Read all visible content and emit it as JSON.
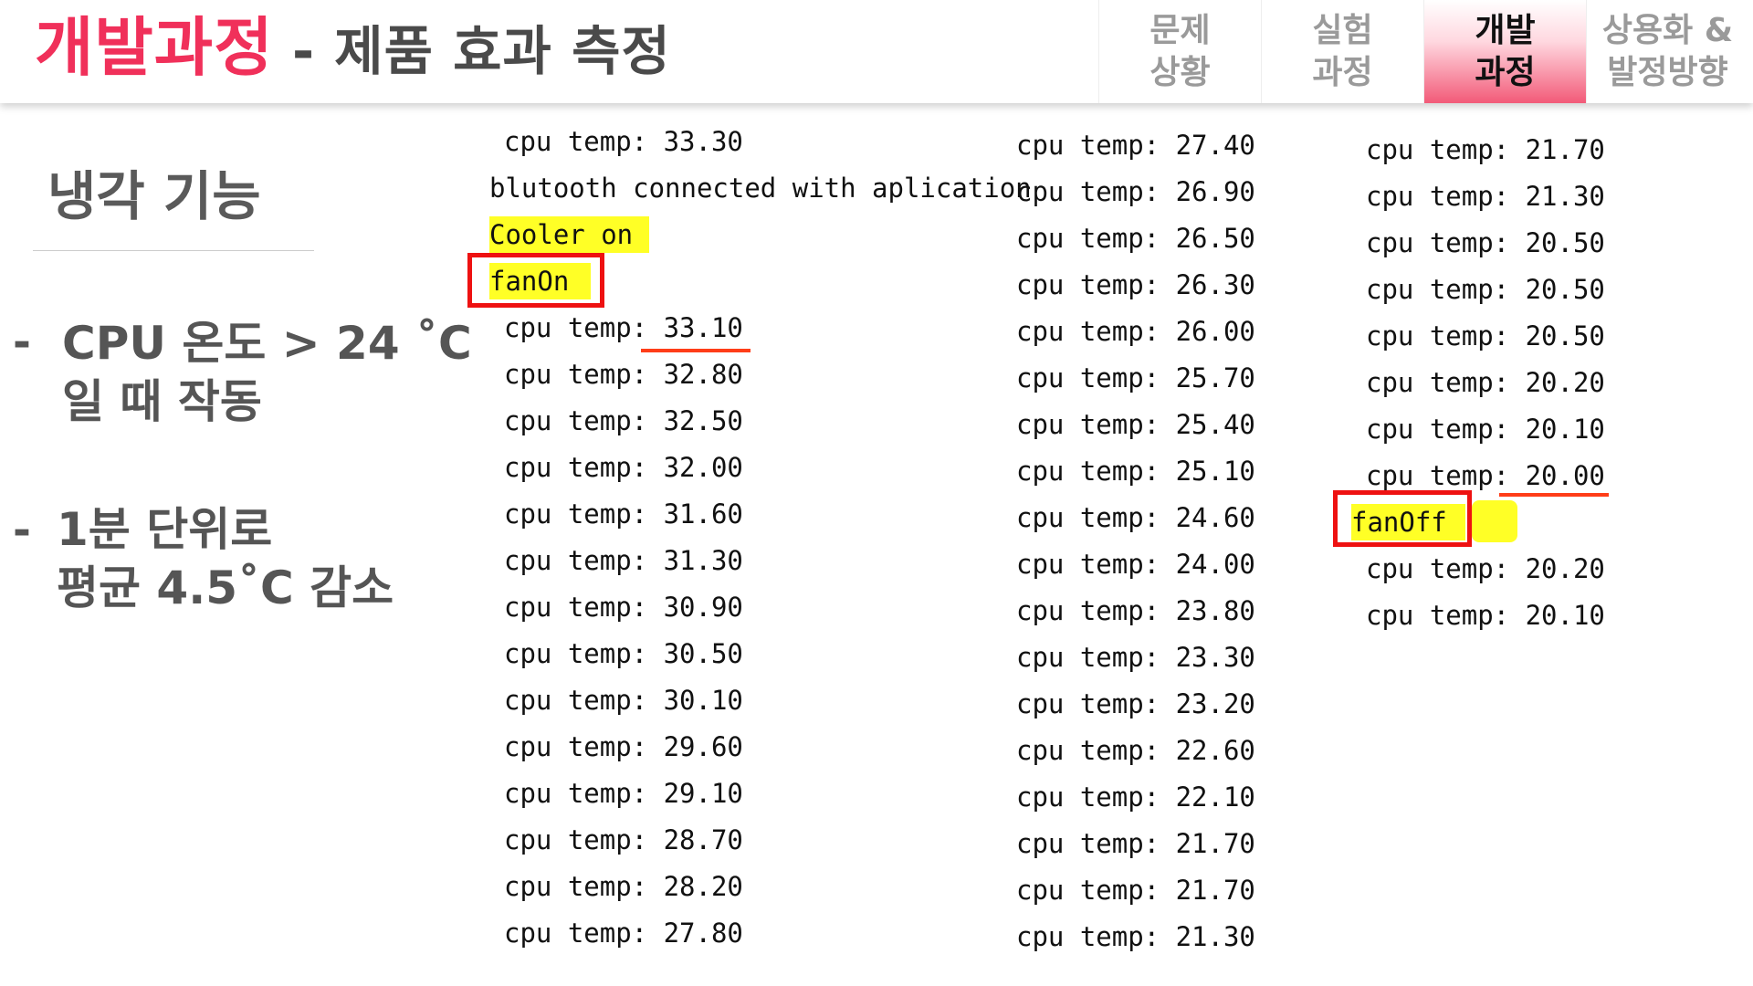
{
  "header": {
    "title_main": "개발과정",
    "title_sub": "- 제품 효과 측정",
    "tabs": [
      {
        "label": "문제\n상황",
        "active": false
      },
      {
        "label": "실험\n과정",
        "active": false
      },
      {
        "label": "개발\n과정",
        "active": true
      },
      {
        "label": "상용화 &\n발정방향",
        "active": false
      }
    ]
  },
  "left": {
    "section_title": "냉각 기능",
    "bullets": [
      {
        "dash": "-",
        "text": "CPU 온도 > 24 ˚C\n일 때 작동"
      },
      {
        "dash": "-",
        "text": "1분 단위로\n평균 4.5˚C  감소"
      }
    ]
  },
  "log": {
    "col1": {
      "first": "cpu temp: 33.30",
      "bt": "blutooth connected with aplication",
      "cooler": "Cooler on",
      "fan_on": "fanOn",
      "temps": [
        "cpu temp: 33.10",
        "cpu temp: 32.80",
        "cpu temp: 32.50",
        "cpu temp: 32.00",
        "cpu temp: 31.60",
        "cpu temp: 31.30",
        "cpu temp: 30.90",
        "cpu temp: 30.50",
        "cpu temp: 30.10",
        "cpu temp: 29.60",
        "cpu temp: 29.10",
        "cpu temp: 28.70",
        "cpu temp: 28.20",
        "cpu temp: 27.80"
      ]
    },
    "col2": {
      "temps": [
        "cpu temp: 27.40",
        "cpu temp: 26.90",
        "cpu temp: 26.50",
        "cpu temp: 26.30",
        "cpu temp: 26.00",
        "cpu temp: 25.70",
        "cpu temp: 25.40",
        "cpu temp: 25.10",
        "cpu temp: 24.60",
        "cpu temp: 24.00",
        "cpu temp: 23.80",
        "cpu temp: 23.30",
        "cpu temp: 23.20",
        "cpu temp: 22.60",
        "cpu temp: 22.10",
        "cpu temp: 21.70",
        "cpu temp: 21.70",
        "cpu temp: 21.30"
      ]
    },
    "col3": {
      "temps_before": [
        "cpu temp: 21.70",
        "cpu temp: 21.30",
        "cpu temp: 20.50",
        "cpu temp: 20.50",
        "cpu temp: 20.50",
        "cpu temp: 20.20",
        "cpu temp: 20.10",
        "cpu temp: 20.00"
      ],
      "fan_off": "fanOff",
      "temps_after": [
        "cpu temp: 20.20",
        "cpu temp: 20.10"
      ]
    }
  },
  "colors": {
    "accent": "#f0305a",
    "highlight": "#ffff26",
    "box": "#ee1111",
    "underline": "#ff3d18"
  }
}
